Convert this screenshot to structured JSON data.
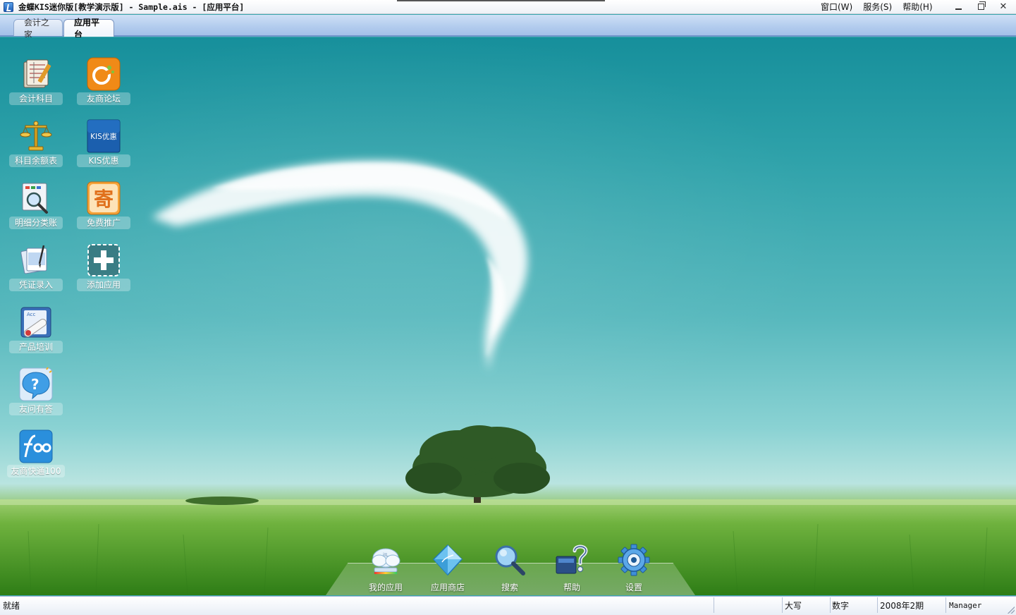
{
  "window": {
    "title": "金蝶KIS迷你版[教学演示版] - Sample.ais - [应用平台]",
    "menu": [
      "窗口(W)",
      "服务(S)",
      "帮助(H)"
    ],
    "controls": [
      "minimize",
      "restore",
      "close"
    ]
  },
  "tabs": [
    {
      "label": "会计之家",
      "active": false
    },
    {
      "label": "应用平台",
      "active": true
    }
  ],
  "desktop_icons": {
    "left": [
      {
        "label": "会计科目",
        "icon": "ledger-book-icon"
      },
      {
        "label": "科目余额表",
        "icon": "scales-icon"
      },
      {
        "label": "明细分类账",
        "icon": "magnifier-report-icon"
      },
      {
        "label": "凭证录入",
        "icon": "voucher-pen-icon"
      },
      {
        "label": "产品培训",
        "icon": "diploma-icon"
      },
      {
        "label": "友问有答",
        "icon": "question-bubble-icon"
      },
      {
        "label": "友商快通100",
        "icon": "f100-logo-icon"
      }
    ],
    "right": [
      {
        "label": "友商论坛",
        "icon": "forum-logo-icon"
      },
      {
        "label": "KIS优惠",
        "icon": "kis-promo-icon",
        "icon_text": "KIS优惠"
      },
      {
        "label": "免费推广",
        "icon": "promo-ji-icon",
        "icon_text": "寄"
      },
      {
        "label": "添加应用",
        "icon": "add-app-icon"
      }
    ]
  },
  "dock": [
    {
      "label": "我的应用",
      "icon": "cloud-apps-icon"
    },
    {
      "label": "应用商店",
      "icon": "diamond-store-icon"
    },
    {
      "label": "搜索",
      "icon": "search-icon"
    },
    {
      "label": "帮助",
      "icon": "help-book-icon"
    },
    {
      "label": "设置",
      "icon": "gear-icon"
    }
  ],
  "statusbar": {
    "status": "就绪",
    "caps": "大写",
    "num": "数字",
    "period": "2008年2期",
    "user": "Manager"
  }
}
